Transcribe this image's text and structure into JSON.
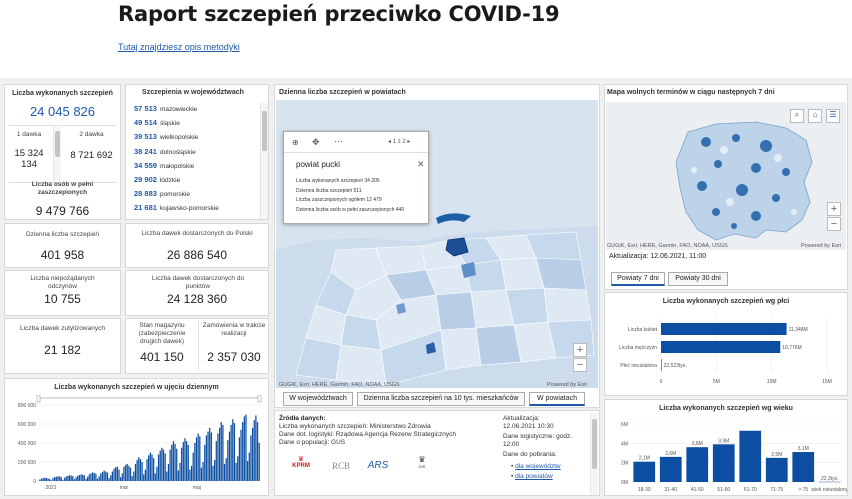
{
  "header": {
    "title": "Raport szczepień przeciwko COVID-19",
    "method_link": "Tutaj znajdziesz opis metodyki"
  },
  "colors": {
    "accent": "#1f5aa8",
    "bar_dark": "#0b4ea2",
    "map_dark": "#1d5fa5",
    "map_light": "#dfe9f4"
  },
  "total": {
    "label": "Liczba wykonanych szczepień",
    "value": "24 045 826",
    "dose1_label": "1 dawka",
    "dose1_value": "15 324 134",
    "dose2_label": "2 dawka",
    "dose2_value": "8 721 692"
  },
  "full": {
    "label": "Liczba osób w pełni zaszczepionych",
    "value": "9 479 766"
  },
  "daily": {
    "label": "Dzienna liczba szczepień",
    "value": "401 958"
  },
  "adverse": {
    "label": "Liczba niepożądanych odczynów",
    "value": "10 755"
  },
  "utilized": {
    "label": "Liczba dawek zutylizowanych",
    "value": "21 182"
  },
  "voiv": {
    "title": "Szczepienia w województwach",
    "items": [
      {
        "value": "57 513",
        "name": "mazowieckie"
      },
      {
        "value": "49 514",
        "name": "śląskie"
      },
      {
        "value": "39 513",
        "name": "wielkopolskie"
      },
      {
        "value": "38 241",
        "name": "dolnośląskie"
      },
      {
        "value": "34 559",
        "name": "małopolskie"
      },
      {
        "value": "29 902",
        "name": "łódzkie"
      },
      {
        "value": "28 883",
        "name": "pomorskie"
      },
      {
        "value": "21 681",
        "name": "kujawsko-pomorskie"
      }
    ]
  },
  "delivered": {
    "label": "Liczba dawek dostarczonych do Polski",
    "value": "26 886 540"
  },
  "to_points": {
    "label": "Liczba dawek dostarczonych do punktów",
    "value": "24 128 360"
  },
  "stock": {
    "label": "Stan magazynu (zabezpieczenie drugich dawek)",
    "value": "401 150"
  },
  "orders": {
    "label": "Zamówienia w trakcie realizacji",
    "value": "2 357 030"
  },
  "timeseries": {
    "title": "Liczba wykonanych szczepień w ujęciu dziennym",
    "yticks": [
      "800 000",
      "600 000",
      "400 000",
      "200 000",
      "0"
    ],
    "xticks": [
      "2021",
      "mar",
      "maj"
    ]
  },
  "county_map": {
    "title": "Dzienna liczba szczepień w powiatach",
    "attribution": "GUGiK, Esri, HERE, Garmin, FAO, NOAA, USGS",
    "powered": "Powered by Esri",
    "popup": {
      "pager": "1 z 2",
      "name": "powiat pucki",
      "rows": [
        "Liczba wykonanych szczepień 34 205",
        "Dzienna liczba szczepień 511",
        "Liczba zaszczepionych ogółem 12 479",
        "Dzienna liczba osób w pełni zaszczepionych 440"
      ]
    },
    "tabs": [
      "W województwach",
      "Dzienna liczba szczepień na 10 tys. mieszkańców",
      "W powiatach"
    ]
  },
  "sources": {
    "title": "Źródła danych:",
    "lines": [
      "Liczba wykonanych szczepień: Ministerstwo Zdrowia",
      "Dane dot. logistyki: Rządowa Agencja Rezerw Strategicznych",
      "Dane o populacji: GUS"
    ],
    "update_label": "Aktualizacja:",
    "update_value": "12.06.2021 10:30",
    "logistic_label": "Dane logistyczne: godz.",
    "logistic_value": "12:00",
    "download_label": "Dane do pobrania:",
    "link1": "dla województw",
    "link2": "dla powiatów",
    "logos": [
      "KPRM",
      "RCB",
      "ARS",
      "GIS"
    ]
  },
  "free_map": {
    "title": "Mapa wolnych terminów w ciągu następnych 7 dni",
    "attribution": "GUGiK, Esri, HERE, Garmin, FAO, NOAA, USGS",
    "powered": "Powered by Esri",
    "update": "Aktualizacja: 12.06.2021, 11:00",
    "tabs": [
      "Powiaty 7 dni",
      "Powiaty 30 dni"
    ]
  },
  "sex_chart": {
    "title": "Liczba wykonanych szczepień wg płci",
    "categories": [
      "Liczba kobiet",
      "Liczba mężczyzn",
      "Płeć nieustalona"
    ],
    "labels": [
      "11,348M",
      "10,776M",
      "22,523tys."
    ],
    "xticks": [
      "0",
      "5M",
      "10M",
      "15M"
    ]
  },
  "age_chart": {
    "title": "Liczba wykonanych szczepień wg wieku",
    "categories": [
      "18-30",
      "31-40",
      "41-50",
      "51-60",
      "61-70",
      "71-75",
      "> 75",
      "wiek nieustalony"
    ],
    "labels": [
      "2,1M",
      "2,6M",
      "3,6M",
      "3,9M",
      "",
      "2,5M",
      "3,1M",
      "22,3tys."
    ],
    "yticks": [
      "6M",
      "4M",
      "2M",
      "0M"
    ]
  },
  "chart_data": [
    {
      "type": "bar",
      "title": "Liczba wykonanych szczepień wg płci",
      "categories": [
        "Liczba kobiet",
        "Liczba mężczyzn",
        "Płeć nieustalona"
      ],
      "values": [
        11.348,
        10.776,
        0.0225
      ],
      "xlim": [
        0,
        15
      ]
    },
    {
      "type": "bar",
      "title": "Liczba wykonanych szczepień wg wieku",
      "categories": [
        "18-30",
        "31-40",
        "41-50",
        "51-60",
        "61-70",
        "71-75",
        "> 75",
        "wiek nieustalony"
      ],
      "values": [
        2.1,
        2.6,
        3.6,
        3.9,
        5.3,
        2.5,
        3.1,
        0.0223
      ],
      "ylim": [
        0,
        6
      ]
    },
    {
      "type": "bar",
      "title": "Liczba wykonanych szczepień w ujęciu dziennym",
      "xticks": [
        "2021",
        "mar",
        "maj"
      ],
      "ylim": [
        0,
        800000
      ],
      "values": [
        15000,
        25000,
        30000,
        35000,
        30000,
        28000,
        20000,
        8000,
        30000,
        40000,
        45000,
        50000,
        48000,
        40000,
        12000,
        35000,
        48000,
        55000,
        60000,
        58000,
        52000,
        20000,
        40000,
        55000,
        62000,
        70000,
        66000,
        60000,
        22000,
        45000,
        70000,
        80000,
        90000,
        85000,
        75000,
        25000,
        50000,
        80000,
        95000,
        110000,
        100000,
        90000,
        30000,
        60000,
        100000,
        130000,
        145000,
        150000,
        120000,
        40000,
        80000,
        150000,
        170000,
        180000,
        160000,
        140000,
        50000,
        100000,
        180000,
        220000,
        250000,
        230000,
        200000,
        70000,
        120000,
        230000,
        270000,
        300000,
        280000,
        240000,
        80000,
        150000,
        280000,
        320000,
        350000,
        330000,
        290000,
        100000,
        180000,
        330000,
        380000,
        420000,
        390000,
        340000,
        110000,
        190000,
        350000,
        410000,
        450000,
        420000,
        380000,
        120000,
        160000,
        300000,
        400000,
        460000,
        500000,
        470000,
        140000,
        200000,
        380000,
        480000,
        520000,
        560000,
        510000,
        160000,
        220000,
        420000,
        500000,
        560000,
        620000,
        590000,
        180000,
        240000,
        430000,
        520000,
        590000,
        650000,
        610000,
        190000,
        260000,
        460000,
        540000,
        620000,
        680000,
        700000,
        210000,
        300000,
        480000,
        560000,
        640000,
        690000,
        620000,
        402000
      ]
    }
  ]
}
